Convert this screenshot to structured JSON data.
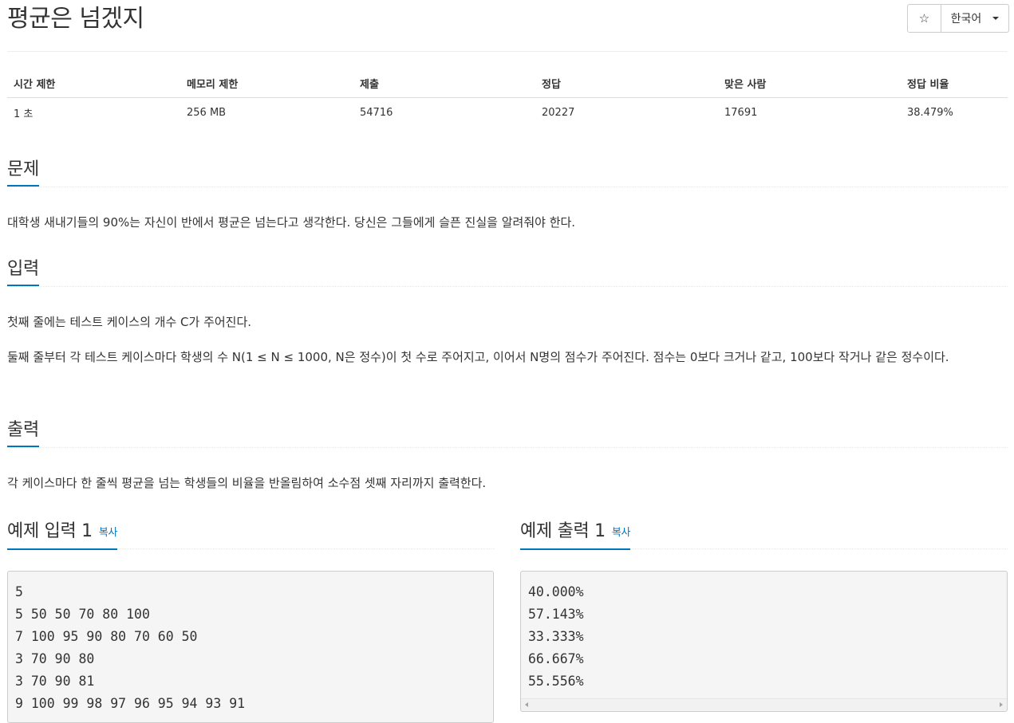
{
  "title": "평균은 넘겠지",
  "controls": {
    "star": "☆",
    "language": "한국어"
  },
  "info_table": {
    "headers": [
      "시간 제한",
      "메모리 제한",
      "제출",
      "정답",
      "맞은 사람",
      "정답 비율"
    ],
    "values": [
      "1 초",
      "256 MB",
      "54716",
      "20227",
      "17691",
      "38.479%"
    ]
  },
  "problem": {
    "heading": "문제",
    "text": "대학생 새내기들의 90%는 자신이 반에서 평균은 넘는다고 생각한다. 당신은 그들에게 슬픈 진실을 알려줘야 한다."
  },
  "input": {
    "heading": "입력",
    "line1": "첫째 줄에는 테스트 케이스의 개수 C가 주어진다.",
    "line2": "둘째 줄부터 각 테스트 케이스마다 학생의 수 N(1 ≤ N ≤ 1000, N은 정수)이 첫 수로 주어지고, 이어서 N명의 점수가 주어진다. 점수는 0보다 크거나 같고, 100보다 작거나 같은 정수이다."
  },
  "output": {
    "heading": "출력",
    "text": "각 케이스마다 한 줄씩 평균을 넘는 학생들의 비율을 반올림하여 소수점 셋째 자리까지 출력한다."
  },
  "sample_input": {
    "heading": "예제 입력 1",
    "copy": "복사",
    "content": "5\n5 50 50 70 80 100\n7 100 95 90 80 70 60 50\n3 70 90 80\n3 70 90 81\n9 100 99 98 97 96 95 94 93 91"
  },
  "sample_output": {
    "heading": "예제 출력 1",
    "copy": "복사",
    "content": "40.000%\n57.143%\n33.333%\n66.667%\n55.556%"
  }
}
